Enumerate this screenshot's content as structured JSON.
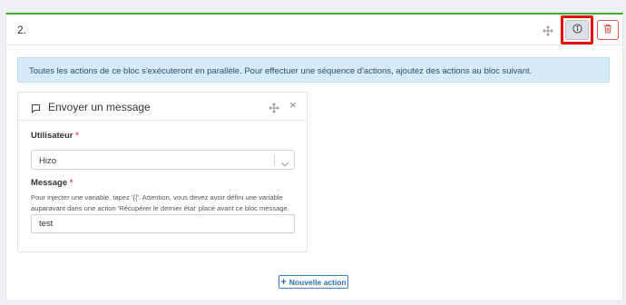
{
  "block": {
    "title": "2."
  },
  "icons": {
    "move": "move-icon",
    "info": "info-icon",
    "delete": "trash-icon",
    "message": "message-flag-icon",
    "close": "close-icon",
    "chevron": "chevron-down-icon",
    "add": "plus-icon"
  },
  "colors": {
    "accent_green": "#3fae2a",
    "highlight_red": "#e31010",
    "danger": "#d9534f",
    "info_bg": "#d6ebf7",
    "primary_blue": "#2a6cb5"
  },
  "notice": {
    "text": "Toutes les actions de ce bloc s'exécuteront en parallèle. Pour effectuer une séquence d'actions, ajoutez des actions au bloc suivant."
  },
  "card": {
    "title": "Envoyer un message",
    "close_glyph": "×",
    "user_label": "Utilisateur",
    "user_required": "*",
    "user_value": "Hizo",
    "message_label": "Message",
    "message_required": "*",
    "message_help": "Pour injecter une variable, tapez '{{'. Attention, vous devez avoir défini une variable auparavant dans une action 'Récupérer le dernier état' placé avant ce bloc message.",
    "message_value": "test"
  },
  "actions": {
    "add_label": "Nouvelle action",
    "add_glyph": "+"
  }
}
